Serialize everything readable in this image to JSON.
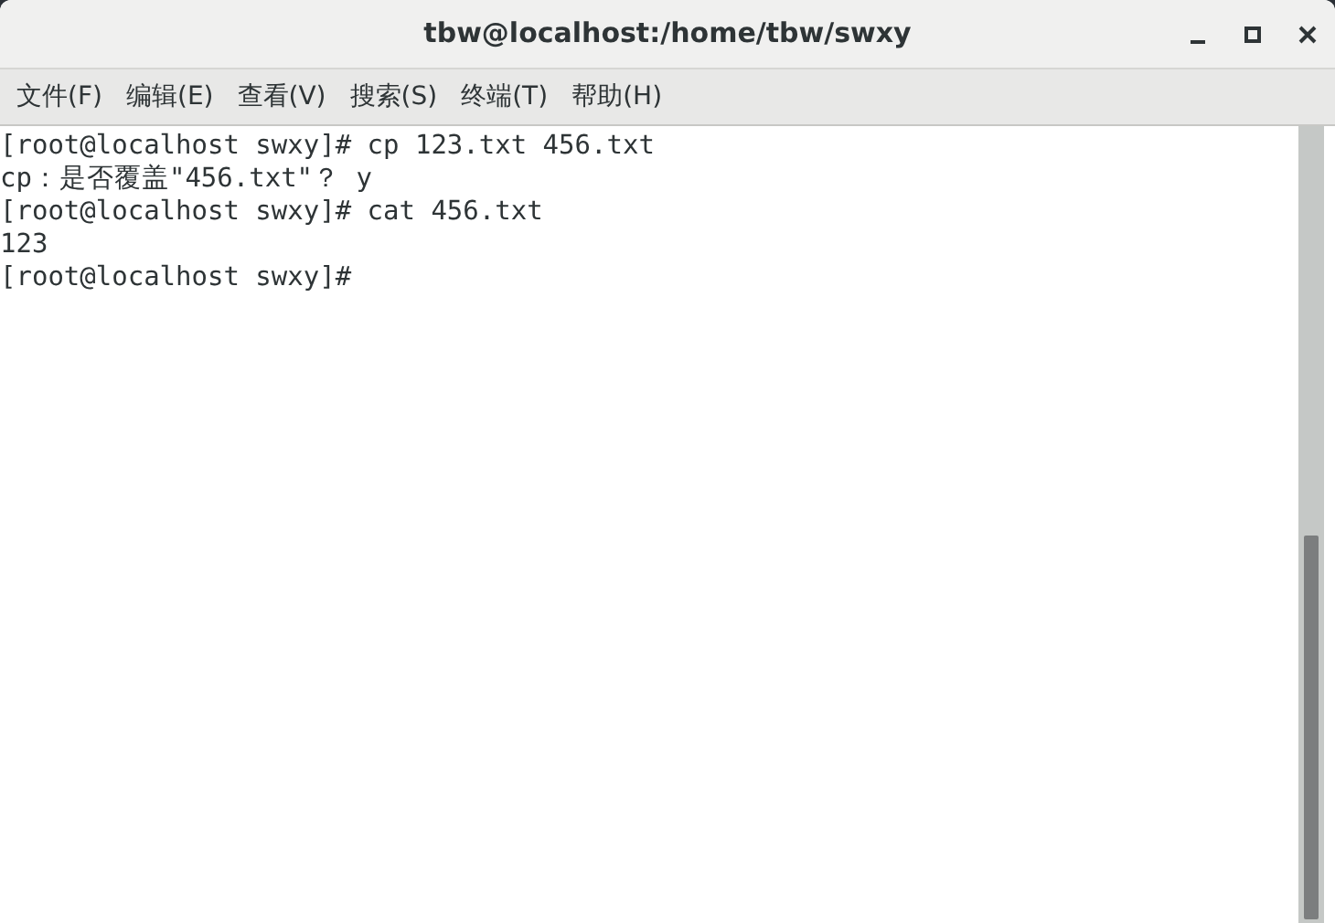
{
  "window": {
    "title": "tbw@localhost:/home/tbw/swxy"
  },
  "menu": [
    "文件(F)",
    "编辑(E)",
    "查看(V)",
    "搜索(S)",
    "终端(T)",
    "帮助(H)"
  ],
  "terminal": {
    "lines": [
      "[root@localhost swxy]# cp 123.txt 456.txt",
      "cp：是否覆盖\"456.txt\"？ y",
      "[root@localhost swxy]# cat 456.txt",
      "123",
      "[root@localhost swxy]#"
    ]
  }
}
